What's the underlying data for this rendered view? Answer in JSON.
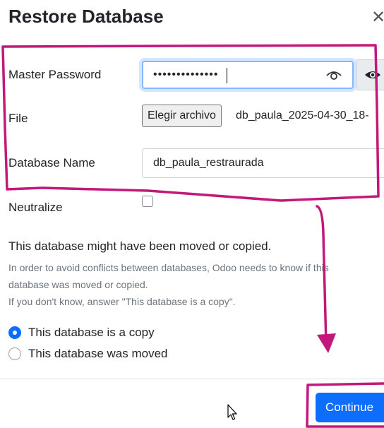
{
  "dialog": {
    "title": "Restore Database",
    "close_icon": "close-icon"
  },
  "form": {
    "master_password": {
      "label": "Master Password",
      "value": "••••••••••••••",
      "show_icon": "eye-icon"
    },
    "file": {
      "label": "File",
      "button_label": "Elegir archivo",
      "file_name": "db_paula_2025-04-30_18-"
    },
    "database_name": {
      "label": "Database Name",
      "value": "db_paula_restraurada"
    },
    "neutralize": {
      "label": "Neutralize",
      "checked": false
    }
  },
  "notice": {
    "heading": "This database might have been moved or copied.",
    "help_line1": "In order to avoid conflicts between databases, Odoo needs to know if this",
    "help_line2": "database was moved or copied.",
    "help_line3": "If you don't know, answer \"This database is a copy\"."
  },
  "options": [
    {
      "label": "This database is a copy",
      "selected": true
    },
    {
      "label": "This database was moved",
      "selected": false
    }
  ],
  "footer": {
    "continue_label": "Continue"
  },
  "annotation_color": "#c2187a",
  "accent_color": "#0d6efd"
}
